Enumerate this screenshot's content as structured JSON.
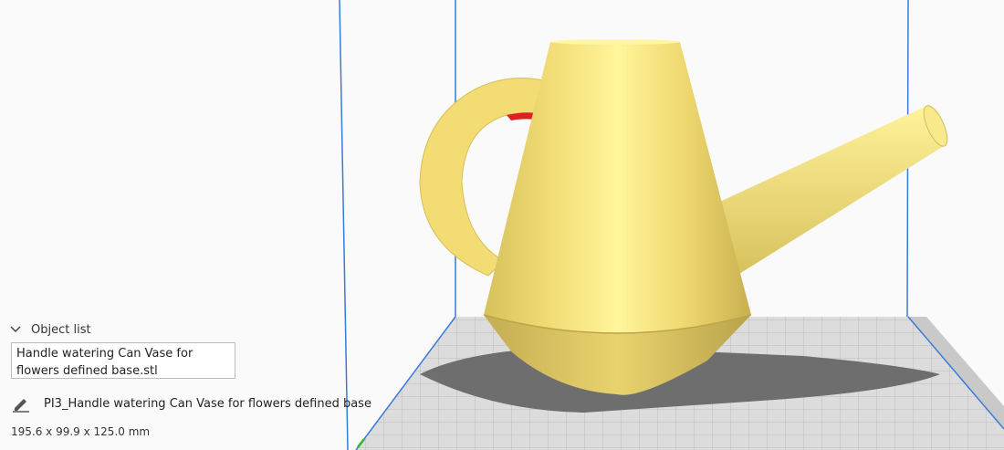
{
  "object_list": {
    "header_label": "Object list",
    "toggle_icon": "chevron-down-icon",
    "items": [
      "Handle watering Can Vase for flowers defined base.stl"
    ]
  },
  "job": {
    "edit_icon": "pencil-icon",
    "name": "PI3_Handle watering Can Vase for flowers defined base"
  },
  "dimensions": "195.6 x 99.9 x 125.0 mm",
  "colors": {
    "model": "#f6e17a",
    "build_volume_lines": "#3a7bd5",
    "build_plate": "#d9d9d9",
    "background": "#fafafa",
    "overhang": "#e02020"
  }
}
